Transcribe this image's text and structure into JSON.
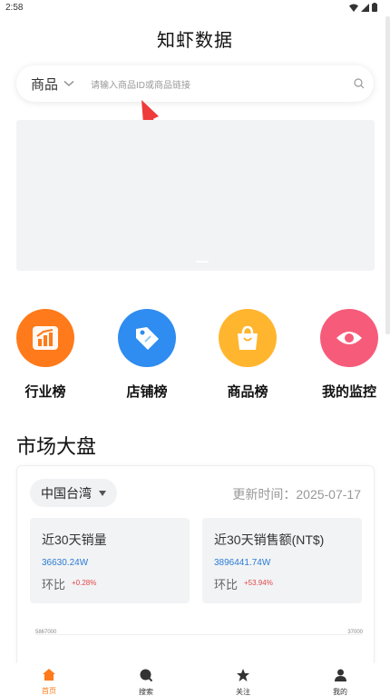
{
  "status_bar": {
    "time": "2:58"
  },
  "app": {
    "title": "知虾数据"
  },
  "search": {
    "type_label": "商品",
    "placeholder": "请输入商品ID或商品链接"
  },
  "quick_links": [
    {
      "label": "行业榜",
      "icon": "chart-up-icon",
      "color": "#ff7a1a"
    },
    {
      "label": "店铺榜",
      "icon": "tag-icon",
      "color": "#2f8cf0"
    },
    {
      "label": "商品榜",
      "icon": "shopping-bag-icon",
      "color": "#ffb52e"
    },
    {
      "label": "我的监控",
      "icon": "eye-icon",
      "color": "#f75b7a"
    }
  ],
  "market": {
    "section_title": "市场大盘",
    "region": "中国台湾",
    "update_time": "更新时间：2025-07-17",
    "metrics": [
      {
        "label": "近30天销量",
        "value": "36630.24W",
        "ratio_label": "环比",
        "ratio": "+0.28%"
      },
      {
        "label": "近30天销售额(NT$)",
        "value": "3896441.74W",
        "ratio_label": "环比",
        "ratio": "+53.94%"
      }
    ],
    "chart_axis": {
      "left": "5867000",
      "right": "37000"
    }
  },
  "tabbar": [
    {
      "label": "首页",
      "icon": "home-icon",
      "active": true
    },
    {
      "label": "搜索",
      "icon": "search-icon",
      "active": false
    },
    {
      "label": "关注",
      "icon": "star-icon",
      "active": false
    },
    {
      "label": "我的",
      "icon": "user-icon",
      "active": false
    }
  ],
  "colors": {
    "accent": "#ff7a1a",
    "link": "#2a7bd4",
    "positive": "#e04848"
  }
}
